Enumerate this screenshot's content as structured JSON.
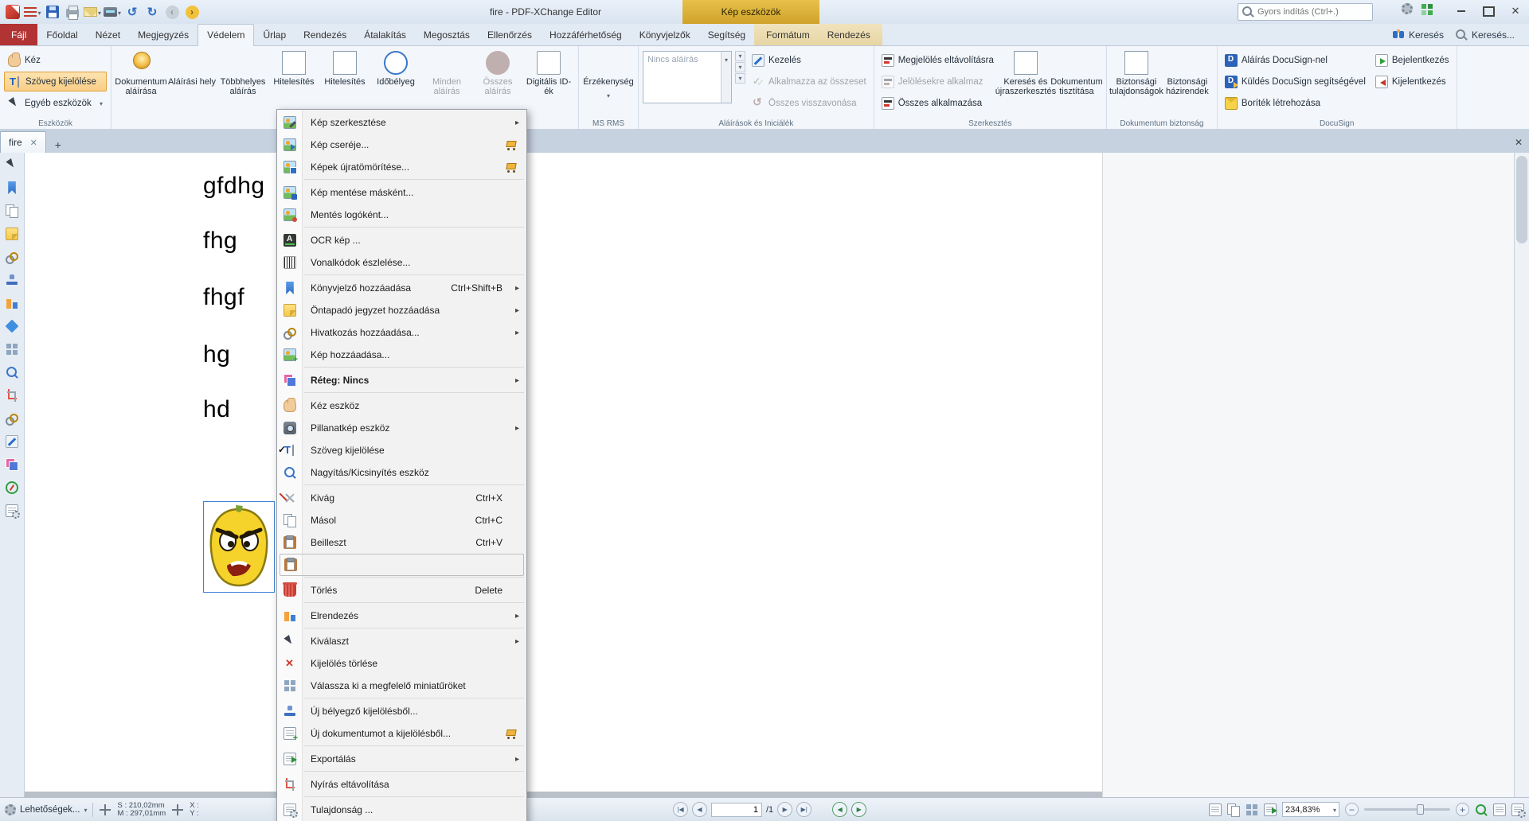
{
  "titlebar": {
    "title": "fire - PDF-XChange Editor",
    "contextual_header": "Kép eszközök",
    "search_placeholder": "Gyors indítás (Ctrl+.)"
  },
  "tabs": {
    "file": "Fájl",
    "main": [
      "Főoldal",
      "Nézet",
      "Megjegyzés",
      "Védelem",
      "Űrlap",
      "Rendezés",
      "Átalakítás",
      "Megosztás",
      "Ellenőrzés",
      "Hozzáférhetőség",
      "Könyvjelzők",
      "Segítség"
    ],
    "active": "Védelem",
    "contextual": [
      "Formátum",
      "Rendezés"
    ],
    "find_label": "Keresés",
    "search_label": "Keresés..."
  },
  "ribbon": {
    "tools": {
      "hand": "Kéz",
      "text_select": "Szöveg kijelölése",
      "other": "Egyéb eszközök",
      "label": "Eszközök"
    },
    "signatures": {
      "buttons": [
        {
          "label": "Dokumentum aláírása",
          "icon": "sign-doc"
        },
        {
          "label": "Aláírási hely",
          "icon": "sign-place"
        },
        {
          "label": "Többhelyes aláírás",
          "icon": "sign-multi"
        },
        {
          "label": "Hitelesítés",
          "icon": "certify"
        },
        {
          "label": "Hitelesítés",
          "icon": "certify2"
        },
        {
          "label": "Időbélyeg",
          "icon": "timestamp"
        },
        {
          "label": "Minden aláírás",
          "icon": "verify-all",
          "disabled": true
        },
        {
          "label": "Összes aláírás",
          "icon": "clear-all",
          "disabled": true
        },
        {
          "label": "Digitális ID-ék",
          "icon": "digital-ids"
        }
      ]
    },
    "ms_rms": {
      "button": "Érzékenység",
      "label": "MS RMS"
    },
    "initials": {
      "combo": "Nincs aláírás",
      "buttons": [
        {
          "label": "Kezelés",
          "icon": "manage"
        },
        {
          "label": "Alkalmazza az összeset",
          "icon": "apply-all",
          "disabled": true
        },
        {
          "label": "Összes visszavonása",
          "icon": "revert-all",
          "disabled": true
        }
      ],
      "label": "Aláírások és Iniciálék"
    },
    "editing": {
      "stack": [
        {
          "label": "Megjelölés eltávolításra",
          "icon": "redact-remove"
        },
        {
          "label": "Jelölésekre alkalmaz",
          "icon": "redact-apply",
          "disabled": true
        },
        {
          "label": "Összes alkalmazása",
          "icon": "redact-apply-all"
        }
      ],
      "big": [
        {
          "label": "Keresés és újraszerkesztés",
          "icon": "redact-search"
        },
        {
          "label": "Dokumentum tisztítása",
          "icon": "sanitize"
        }
      ],
      "label": "Szerkesztés"
    },
    "security": {
      "big": [
        {
          "label": "Biztonsági tulajdonságok",
          "icon": "security-props"
        },
        {
          "label": "Biztonsági házirendek",
          "icon": "security-policies"
        }
      ],
      "label": "Dokumentum biztonság"
    },
    "docusign": {
      "left": [
        {
          "label": "Aláírás DocuSign-nel",
          "icon": "docusign-sign"
        },
        {
          "label": "Küldés DocuSign segítségével",
          "icon": "docusign-send"
        },
        {
          "label": "Boríték létrehozása",
          "icon": "docusign-envelope"
        }
      ],
      "right": [
        {
          "label": "Bejelentkezés",
          "icon": "login"
        },
        {
          "label": "Kijelentkezés",
          "icon": "logout"
        }
      ],
      "label": "DocuSign"
    }
  },
  "document": {
    "tab_title": "fire",
    "lines": [
      "gfdhg",
      "fhg",
      "fhgf",
      "hg",
      "hd"
    ]
  },
  "sidebar_tools": [
    "select-tool",
    "bookmarks",
    "pages",
    "comments",
    "attachments",
    "stamps",
    "form-fields",
    "3d-content",
    "thumbnails",
    "destinations",
    "measure",
    "links",
    "signatures",
    "split-view",
    "navigate",
    "document-parts"
  ],
  "context_menu": {
    "items": [
      {
        "label": "Kép szerkesztése",
        "icon": "img-edit",
        "submenu": true
      },
      {
        "label": "Kép cseréje...",
        "icon": "img-replace",
        "cart": true
      },
      {
        "label": "Képek újratömörítése...",
        "icon": "img-compress",
        "cart": true
      },
      {
        "type": "separator"
      },
      {
        "label": "Kép mentése másként...",
        "icon": "img-save"
      },
      {
        "label": "Mentés logóként...",
        "icon": "img-logo"
      },
      {
        "type": "separator"
      },
      {
        "label": "OCR kép ...",
        "icon": "ocr"
      },
      {
        "label": "Vonalkódok észlelése...",
        "icon": "barcode"
      },
      {
        "type": "separator"
      },
      {
        "label": "Könyvjelző hozzáadása",
        "icon": "bookmark",
        "shortcut": "Ctrl+Shift+B",
        "submenu": true
      },
      {
        "label": "Öntapadó jegyzet hozzáadása",
        "icon": "note",
        "submenu": true
      },
      {
        "label": "Hivatkozás hozzáadása...",
        "icon": "link",
        "submenu": true
      },
      {
        "label": "Kép hozzáadása...",
        "icon": "img-add"
      },
      {
        "type": "separator"
      },
      {
        "label": "Réteg: Nincs",
        "icon": "layer",
        "submenu": true,
        "bold": true
      },
      {
        "type": "separator"
      },
      {
        "label": "Kéz eszköz",
        "icon": "hand"
      },
      {
        "label": "Pillanatkép eszköz",
        "icon": "camera",
        "submenu": true
      },
      {
        "label": "Szöveg kijelölése",
        "icon": "textsel",
        "checked": true
      },
      {
        "label": "Nagyítás/Kicsinyítés eszköz",
        "icon": "zoom"
      },
      {
        "type": "separator"
      },
      {
        "label": "Kivág",
        "icon": "cut",
        "shortcut": "Ctrl+X"
      },
      {
        "label": "Másol",
        "icon": "copy",
        "shortcut": "Ctrl+C"
      },
      {
        "label": "Beilleszt",
        "icon": "paste",
        "shortcut": "Ctrl+V"
      },
      {
        "label": "",
        "icon": "paste2",
        "framed": true
      },
      {
        "type": "separator"
      },
      {
        "label": "Törlés",
        "icon": "trash",
        "shortcut": "Delete"
      },
      {
        "type": "separator"
      },
      {
        "label": "Elrendezés",
        "icon": "arrange",
        "submenu": true
      },
      {
        "type": "separator"
      },
      {
        "label": "Kiválaszt",
        "icon": "cursor",
        "submenu": true
      },
      {
        "label": "Kijelölés törlése",
        "icon": "redx"
      },
      {
        "label": "Válassza ki a megfelelő miniatűröket",
        "icon": "grid"
      },
      {
        "type": "separator"
      },
      {
        "label": "Új bélyegző kijelölésből...",
        "icon": "stamp"
      },
      {
        "label": "Új dokumentumot a kijelölésből...",
        "icon": "doc-new",
        "cart": true
      },
      {
        "type": "separator"
      },
      {
        "label": "Exportálás",
        "icon": "export",
        "submenu": true
      },
      {
        "type": "separator"
      },
      {
        "label": "Nyírás eltávolítása",
        "icon": "crop"
      },
      {
        "type": "separator"
      },
      {
        "label": "Tulajdonság ...",
        "icon": "props"
      }
    ]
  },
  "statusbar": {
    "options": "Lehetőségek...",
    "size_s": "S : 210,02mm",
    "size_m": "M : 297,01mm",
    "coord_x": "X :",
    "coord_y": "Y :",
    "page_current": "1",
    "page_total": "/1",
    "zoom": "234,83%"
  },
  "colors": {
    "contextual_tab": "#d9ad35",
    "file_tab": "#b23333",
    "tool_highlight": "#f9cd85",
    "selection_blue": "#3f7fd6"
  }
}
